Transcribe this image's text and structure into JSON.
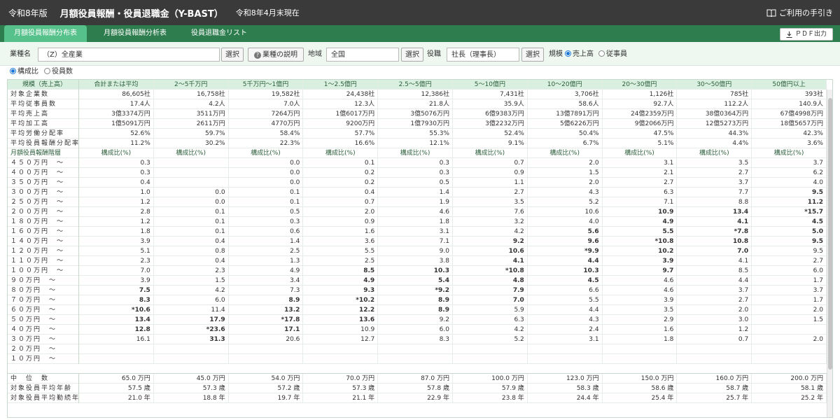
{
  "header": {
    "edition": "令和8年版",
    "title": "月額役員報酬・役員退職金（Y-BAST）",
    "as_of": "令和8年4月末現在",
    "help_label": "ご利用の手引き"
  },
  "tabs": [
    {
      "label": "月額役員報酬分布表",
      "active": true
    },
    {
      "label": "月額役員報酬分析表",
      "active": false
    },
    {
      "label": "役員退職金リスト",
      "active": false
    }
  ],
  "pdf_button": "ＰＤＦ出力",
  "filters": {
    "industry_label": "業種名",
    "industry_value": "（Z）全産業",
    "select_label": "選択",
    "industry_help": "業種の説明",
    "region_label": "地域",
    "region_value": "全国",
    "position_label": "役職",
    "position_value": "社長（理事長）",
    "scale_label": "規模",
    "scale_options": [
      {
        "label": "売上高",
        "selected": true
      },
      {
        "label": "従事員",
        "selected": false
      }
    ]
  },
  "mode_options": [
    {
      "label": "構成比",
      "selected": true
    },
    {
      "label": "役員数",
      "selected": false
    }
  ],
  "table": {
    "corner": "規模（売上高）",
    "columns": [
      "合計または平均",
      "2～5千万円",
      "5千万円～1億円",
      "1～2.5億円",
      "2.5～5億円",
      "5～10億円",
      "10～20億円",
      "20～30億円",
      "30～50億円",
      "50億円以上"
    ],
    "summary_rows": [
      {
        "label": "対象企業数",
        "values": [
          "86,605社",
          "16,758社",
          "19,582社",
          "24,438社",
          "12,386社",
          "7,431社",
          "3,706社",
          "1,126社",
          "785社",
          "393社"
        ]
      },
      {
        "label": "平均従事員数",
        "values": [
          "17.4人",
          "4.2人",
          "7.0人",
          "12.3人",
          "21.8人",
          "35.9人",
          "58.6人",
          "92.7人",
          "112.2人",
          "140.9人"
        ]
      },
      {
        "label": "平均売上高",
        "values": [
          "3億3374万円",
          "3511万円",
          "7264万円",
          "1億6017万円",
          "3億5076万円",
          "6億9383万円",
          "13億7891万円",
          "24億2359万円",
          "38億0364万円",
          "67億4998万円"
        ]
      },
      {
        "label": "平均加工高",
        "values": [
          "1億5091万円",
          "2611万円",
          "4770万円",
          "9200万円",
          "1億7930万円",
          "3億2232万円",
          "5億6226万円",
          "9億2066万円",
          "12億5273万円",
          "18億5657万円"
        ]
      },
      {
        "label": "平均労働分配率",
        "values": [
          "52.6%",
          "59.7%",
          "58.4%",
          "57.7%",
          "55.3%",
          "52.4%",
          "50.4%",
          "47.5%",
          "44.3%",
          "42.3%"
        ]
      },
      {
        "label": "平均役員報酬分配率",
        "values": [
          "11.2%",
          "30.2%",
          "22.3%",
          "16.6%",
          "12.1%",
          "9.1%",
          "6.7%",
          "5.1%",
          "4.4%",
          "3.6%"
        ]
      }
    ],
    "dist_header_label": "月額役員報酬階層",
    "dist_col_label": "構成比(%)",
    "dist_rows": [
      {
        "label": "４５０万円　～",
        "values": [
          "0.3",
          "",
          "0.0",
          "0.1",
          "0.3",
          "0.7",
          "2.0",
          "3.1",
          "3.5",
          "3.7"
        ],
        "bold": []
      },
      {
        "label": "４００万円　～",
        "values": [
          "0.3",
          "",
          "0.0",
          "0.2",
          "0.3",
          "0.9",
          "1.5",
          "2.1",
          "2.7",
          "6.2"
        ],
        "bold": []
      },
      {
        "label": "３５０万円　～",
        "values": [
          "0.4",
          "",
          "0.0",
          "0.2",
          "0.5",
          "1.1",
          "2.0",
          "2.7",
          "3.7",
          "4.0"
        ],
        "bold": []
      },
      {
        "label": "３００万円　～",
        "values": [
          "1.0",
          "0.0",
          "0.1",
          "0.4",
          "1.4",
          "2.7",
          "4.3",
          "6.3",
          "7.7",
          "9.5"
        ],
        "bold": [
          9
        ]
      },
      {
        "label": "２５０万円　～",
        "values": [
          "1.2",
          "0.0",
          "0.1",
          "0.7",
          "1.9",
          "3.5",
          "5.2",
          "7.1",
          "8.8",
          "11.2"
        ],
        "bold": [
          9
        ]
      },
      {
        "label": "２００万円　～",
        "values": [
          "2.8",
          "0.1",
          "0.5",
          "2.0",
          "4.6",
          "7.6",
          "10.6",
          "10.9",
          "13.4",
          "*15.7"
        ],
        "bold": [
          7,
          8,
          9
        ]
      },
      {
        "label": "１８０万円　～",
        "values": [
          "1.2",
          "0.1",
          "0.3",
          "0.9",
          "1.8",
          "3.2",
          "4.0",
          "4.9",
          "4.1",
          "4.5"
        ],
        "bold": [
          7,
          8,
          9
        ]
      },
      {
        "label": "１６０万円　～",
        "values": [
          "1.8",
          "0.1",
          "0.6",
          "1.6",
          "3.1",
          "4.2",
          "5.6",
          "5.5",
          "*7.8",
          "5.0"
        ],
        "bold": [
          6,
          7,
          8,
          9
        ]
      },
      {
        "label": "１４０万円　～",
        "values": [
          "3.9",
          "0.4",
          "1.4",
          "3.6",
          "7.1",
          "9.2",
          "9.6",
          "*10.8",
          "10.8",
          "9.5"
        ],
        "bold": [
          5,
          6,
          7,
          8,
          9
        ]
      },
      {
        "label": "１２０万円　～",
        "values": [
          "5.1",
          "0.8",
          "2.5",
          "5.5",
          "9.0",
          "10.6",
          "*9.9",
          "10.2",
          "7.0",
          "9.5"
        ],
        "bold": [
          5,
          6,
          7,
          8
        ]
      },
      {
        "label": "１１０万円　～",
        "values": [
          "2.3",
          "0.4",
          "1.3",
          "2.5",
          "3.8",
          "4.1",
          "4.4",
          "3.9",
          "4.1",
          "2.7"
        ],
        "bold": [
          5,
          6,
          7
        ]
      },
      {
        "label": "１００万円　～",
        "values": [
          "7.0",
          "2.3",
          "4.9",
          "8.5",
          "10.3",
          "*10.8",
          "10.3",
          "9.7",
          "8.5",
          "6.0"
        ],
        "bold": [
          3,
          4,
          5,
          6,
          7
        ]
      },
      {
        "label": "９０万円　～",
        "values": [
          "3.9",
          "1.5",
          "3.4",
          "4.9",
          "5.4",
          "4.8",
          "4.5",
          "4.6",
          "4.4",
          "1.7"
        ],
        "bold": [
          3,
          4,
          5,
          6
        ]
      },
      {
        "label": "８０万円　～",
        "values": [
          "7.5",
          "4.2",
          "7.3",
          "9.3",
          "*9.2",
          "7.9",
          "6.6",
          "4.6",
          "3.7",
          "3.7"
        ],
        "bold": [
          0,
          3,
          4,
          5
        ]
      },
      {
        "label": "７０万円　～",
        "values": [
          "8.3",
          "6.0",
          "8.9",
          "*10.2",
          "8.9",
          "7.0",
          "5.5",
          "3.9",
          "2.7",
          "1.7"
        ],
        "bold": [
          0,
          2,
          3,
          4,
          5
        ]
      },
      {
        "label": "６０万円　～",
        "values": [
          "*10.6",
          "11.4",
          "13.2",
          "12.2",
          "8.9",
          "5.9",
          "4.4",
          "3.5",
          "2.0",
          "2.0"
        ],
        "bold": [
          0,
          2,
          3,
          4
        ]
      },
      {
        "label": "５０万円　～",
        "values": [
          "13.4",
          "17.9",
          "*17.8",
          "13.6",
          "9.2",
          "6.3",
          "4.3",
          "2.9",
          "3.0",
          "1.5"
        ],
        "bold": [
          0,
          1,
          2,
          3
        ]
      },
      {
        "label": "４０万円　～",
        "values": [
          "12.8",
          "*23.6",
          "17.1",
          "10.9",
          "6.0",
          "4.2",
          "2.4",
          "1.6",
          "1.2",
          ""
        ],
        "bold": [
          0,
          1,
          2
        ]
      },
      {
        "label": "３０万円　～",
        "values": [
          "16.1",
          "31.3",
          "20.6",
          "12.7",
          "8.3",
          "5.2",
          "3.1",
          "1.8",
          "0.7",
          "2.0"
        ],
        "bold": [
          1
        ]
      },
      {
        "label": "２０万円　～",
        "values": [
          "",
          "",
          "",
          "",
          "",
          "",
          "",
          "",
          "",
          ""
        ],
        "bold": []
      },
      {
        "label": "１０万円　～",
        "values": [
          "",
          "",
          "",
          "",
          "",
          "",
          "",
          "",
          "",
          ""
        ],
        "bold": []
      }
    ],
    "footer_rows": [
      {
        "label": "中　位　数",
        "values": [
          "65.0 万円",
          "45.0 万円",
          "54.0 万円",
          "70.0 万円",
          "87.0 万円",
          "100.0 万円",
          "123.0 万円",
          "150.0 万円",
          "160.0 万円",
          "200.0 万円"
        ]
      },
      {
        "label": "対象役員平均年齢",
        "values": [
          "57.5 歳",
          "57.3 歳",
          "57.2 歳",
          "57.3 歳",
          "57.8 歳",
          "57.9 歳",
          "58.3 歳",
          "58.6 歳",
          "58.7 歳",
          "58.1 歳"
        ]
      },
      {
        "label": "対象役員平均勤続年数",
        "values": [
          "21.0 年",
          "18.8 年",
          "19.7 年",
          "21.1 年",
          "22.9 年",
          "23.8 年",
          "24.4 年",
          "25.4 年",
          "25.7 年",
          "25.2 年"
        ]
      }
    ]
  }
}
